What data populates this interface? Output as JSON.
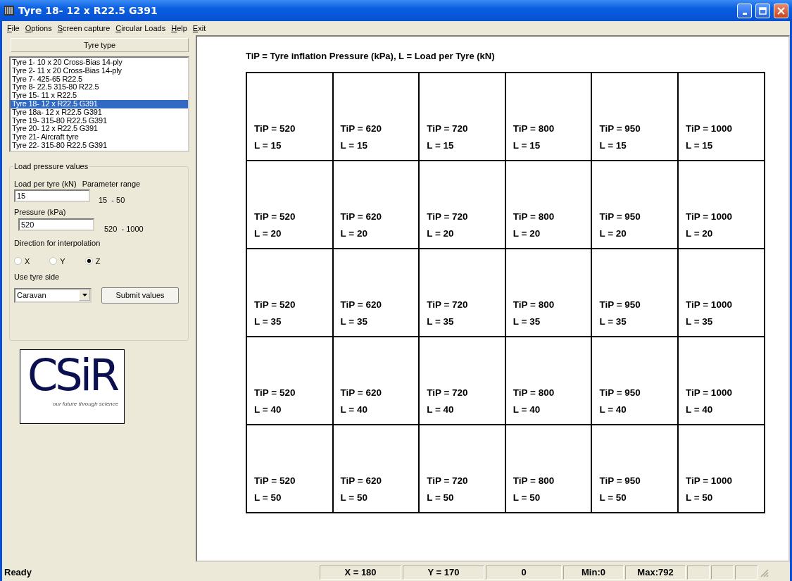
{
  "window": {
    "title": "Tyre 18- 12 x R22.5 G391"
  },
  "menu": [
    "File",
    "Options",
    "Screen capture",
    "Circular Loads",
    "Help",
    "Exit"
  ],
  "tyre_list": {
    "header": "Tyre type",
    "items": [
      {
        "label": "Tyre 1- 10 x 20 Cross-Bias 14-ply",
        "selected": false
      },
      {
        "label": "Tyre 2- 11 x 20 Cross-Bias 14-ply",
        "selected": false
      },
      {
        "label": "Tyre 7- 425-65 R22.5",
        "selected": false
      },
      {
        "label": "Tyre 8- 22.5 315-80 R22.5",
        "selected": false
      },
      {
        "label": "Tyre 15- 11 x R22.5",
        "selected": false
      },
      {
        "label": "Tyre 18- 12 x R22.5 G391",
        "selected": true
      },
      {
        "label": "Tyre 18a- 12 x R22.5 G391",
        "selected": false
      },
      {
        "label": "Tyre 19- 315-80 R22.5 G391",
        "selected": false
      },
      {
        "label": "Tyre 20- 12 x R22.5 G391",
        "selected": false
      },
      {
        "label": "Tyre 21- Aircraft tyre",
        "selected": false
      },
      {
        "label": "Tyre 22- 315-80 R22.5 G391",
        "selected": false
      }
    ]
  },
  "load_pressure": {
    "title": "Load pressure values",
    "load_label": "Load per tyre (kN)",
    "range_label": "Parameter range",
    "load_value": "15",
    "load_range": "15  - 50",
    "pressure_label": "Pressure (kPa)",
    "pressure_value": "520",
    "pressure_range": "520  - 1000",
    "direction_label": "Direction for interpolation",
    "directions": [
      {
        "label": "X",
        "selected": false
      },
      {
        "label": "Y",
        "selected": false
      },
      {
        "label": "Z",
        "selected": true
      }
    ],
    "side_label": "Use tyre side",
    "side_value": "Caravan",
    "submit": "Submit values"
  },
  "logo": {
    "wordmark": "CSiR",
    "tagline": "our future through science"
  },
  "canvas": {
    "legend": "TiP = Tyre inflation Pressure (kPa), L = Load per Tyre (kN)",
    "rows": [
      [
        {
          "pressure": "TiP = 520",
          "load": "L = 15"
        },
        {
          "pressure": "TiP = 620",
          "load": "L = 15"
        },
        {
          "pressure": "TiP = 720",
          "load": "L = 15"
        },
        {
          "pressure": "TiP = 800",
          "load": "L = 15"
        },
        {
          "pressure": "TiP = 950",
          "load": "L = 15"
        },
        {
          "pressure": "TiP = 1000",
          "load": "L = 15"
        }
      ],
      [
        {
          "pressure": "TiP = 520",
          "load": "L = 20"
        },
        {
          "pressure": "TiP = 620",
          "load": "L = 20"
        },
        {
          "pressure": "TiP = 720",
          "load": "L = 20"
        },
        {
          "pressure": "TiP = 800",
          "load": "L = 20"
        },
        {
          "pressure": "TiP = 950",
          "load": "L = 20"
        },
        {
          "pressure": "TiP = 1000",
          "load": "L = 20"
        }
      ],
      [
        {
          "pressure": "TiP = 520",
          "load": "L = 35"
        },
        {
          "pressure": "TiP = 620",
          "load": "L = 35"
        },
        {
          "pressure": "TiP = 720",
          "load": "L = 35"
        },
        {
          "pressure": "TiP = 800",
          "load": "L = 35"
        },
        {
          "pressure": "TiP = 950",
          "load": "L = 35"
        },
        {
          "pressure": "TiP = 1000",
          "load": "L = 35"
        }
      ],
      [
        {
          "pressure": "TiP = 520",
          "load": "L = 40"
        },
        {
          "pressure": "TiP = 620",
          "load": "L = 40"
        },
        {
          "pressure": "TiP = 720",
          "load": "L = 40"
        },
        {
          "pressure": "TiP = 800",
          "load": "L = 40"
        },
        {
          "pressure": "TiP = 950",
          "load": "L = 40"
        },
        {
          "pressure": "TiP = 1000",
          "load": "L = 40"
        }
      ],
      [
        {
          "pressure": "TiP = 520",
          "load": "L = 50"
        },
        {
          "pressure": "TiP = 620",
          "load": "L = 50"
        },
        {
          "pressure": "TiP = 720",
          "load": "L = 50"
        },
        {
          "pressure": "TiP = 800",
          "load": "L = 50"
        },
        {
          "pressure": "TiP = 950",
          "load": "L = 50"
        },
        {
          "pressure": "TiP = 1000",
          "load": "L = 50"
        }
      ]
    ]
  },
  "status_bar": {
    "message": "Ready",
    "panels": [
      "X = 180",
      "Y = 170",
      "0",
      "Min:0",
      "Max:792"
    ]
  }
}
